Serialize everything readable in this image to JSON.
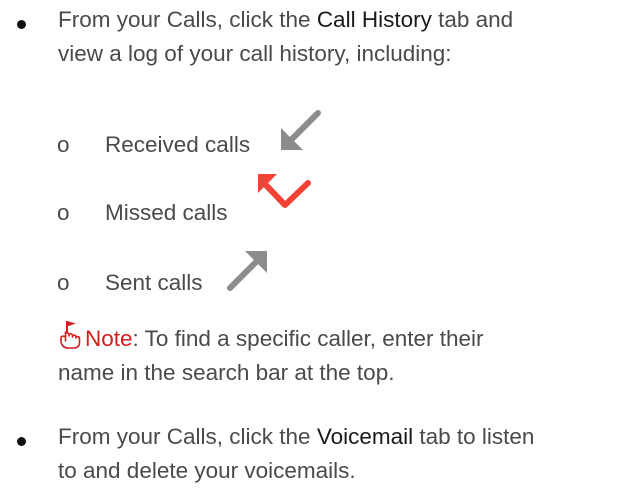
{
  "bullet1": {
    "prefix": "From your Calls, click the ",
    "highlight": "Call History",
    "suffix_line1": " tab and",
    "line2": "view a log of your call history, including:"
  },
  "sub_items": [
    {
      "marker": "o",
      "label": "Received calls",
      "icon": "arrow-down-left-icon",
      "color": "#8c8c8c"
    },
    {
      "marker": "o",
      "label": "Missed calls",
      "icon": "missed-call-arrow-icon",
      "color": "#f44336"
    },
    {
      "marker": "o",
      "label": "Sent calls",
      "icon": "arrow-up-right-icon",
      "color": "#8c8c8c"
    }
  ],
  "note": {
    "icon": "pointing-hand-flag-icon",
    "label": "Note",
    "text_line1": ": To find a specific caller, enter their",
    "text_line2": "name in the search bar at the top."
  },
  "bullet2": {
    "prefix": "From your Calls, click the ",
    "highlight": "Voicemail",
    "suffix_line1": " tab to listen",
    "line2": "to and delete your voicemails."
  },
  "colors": {
    "body_text": "#4a4a4a",
    "highlight_text": "#1a1a1a",
    "note_red": "#d81b1b",
    "arrow_gray": "#8c8c8c",
    "arrow_red": "#f44336"
  }
}
